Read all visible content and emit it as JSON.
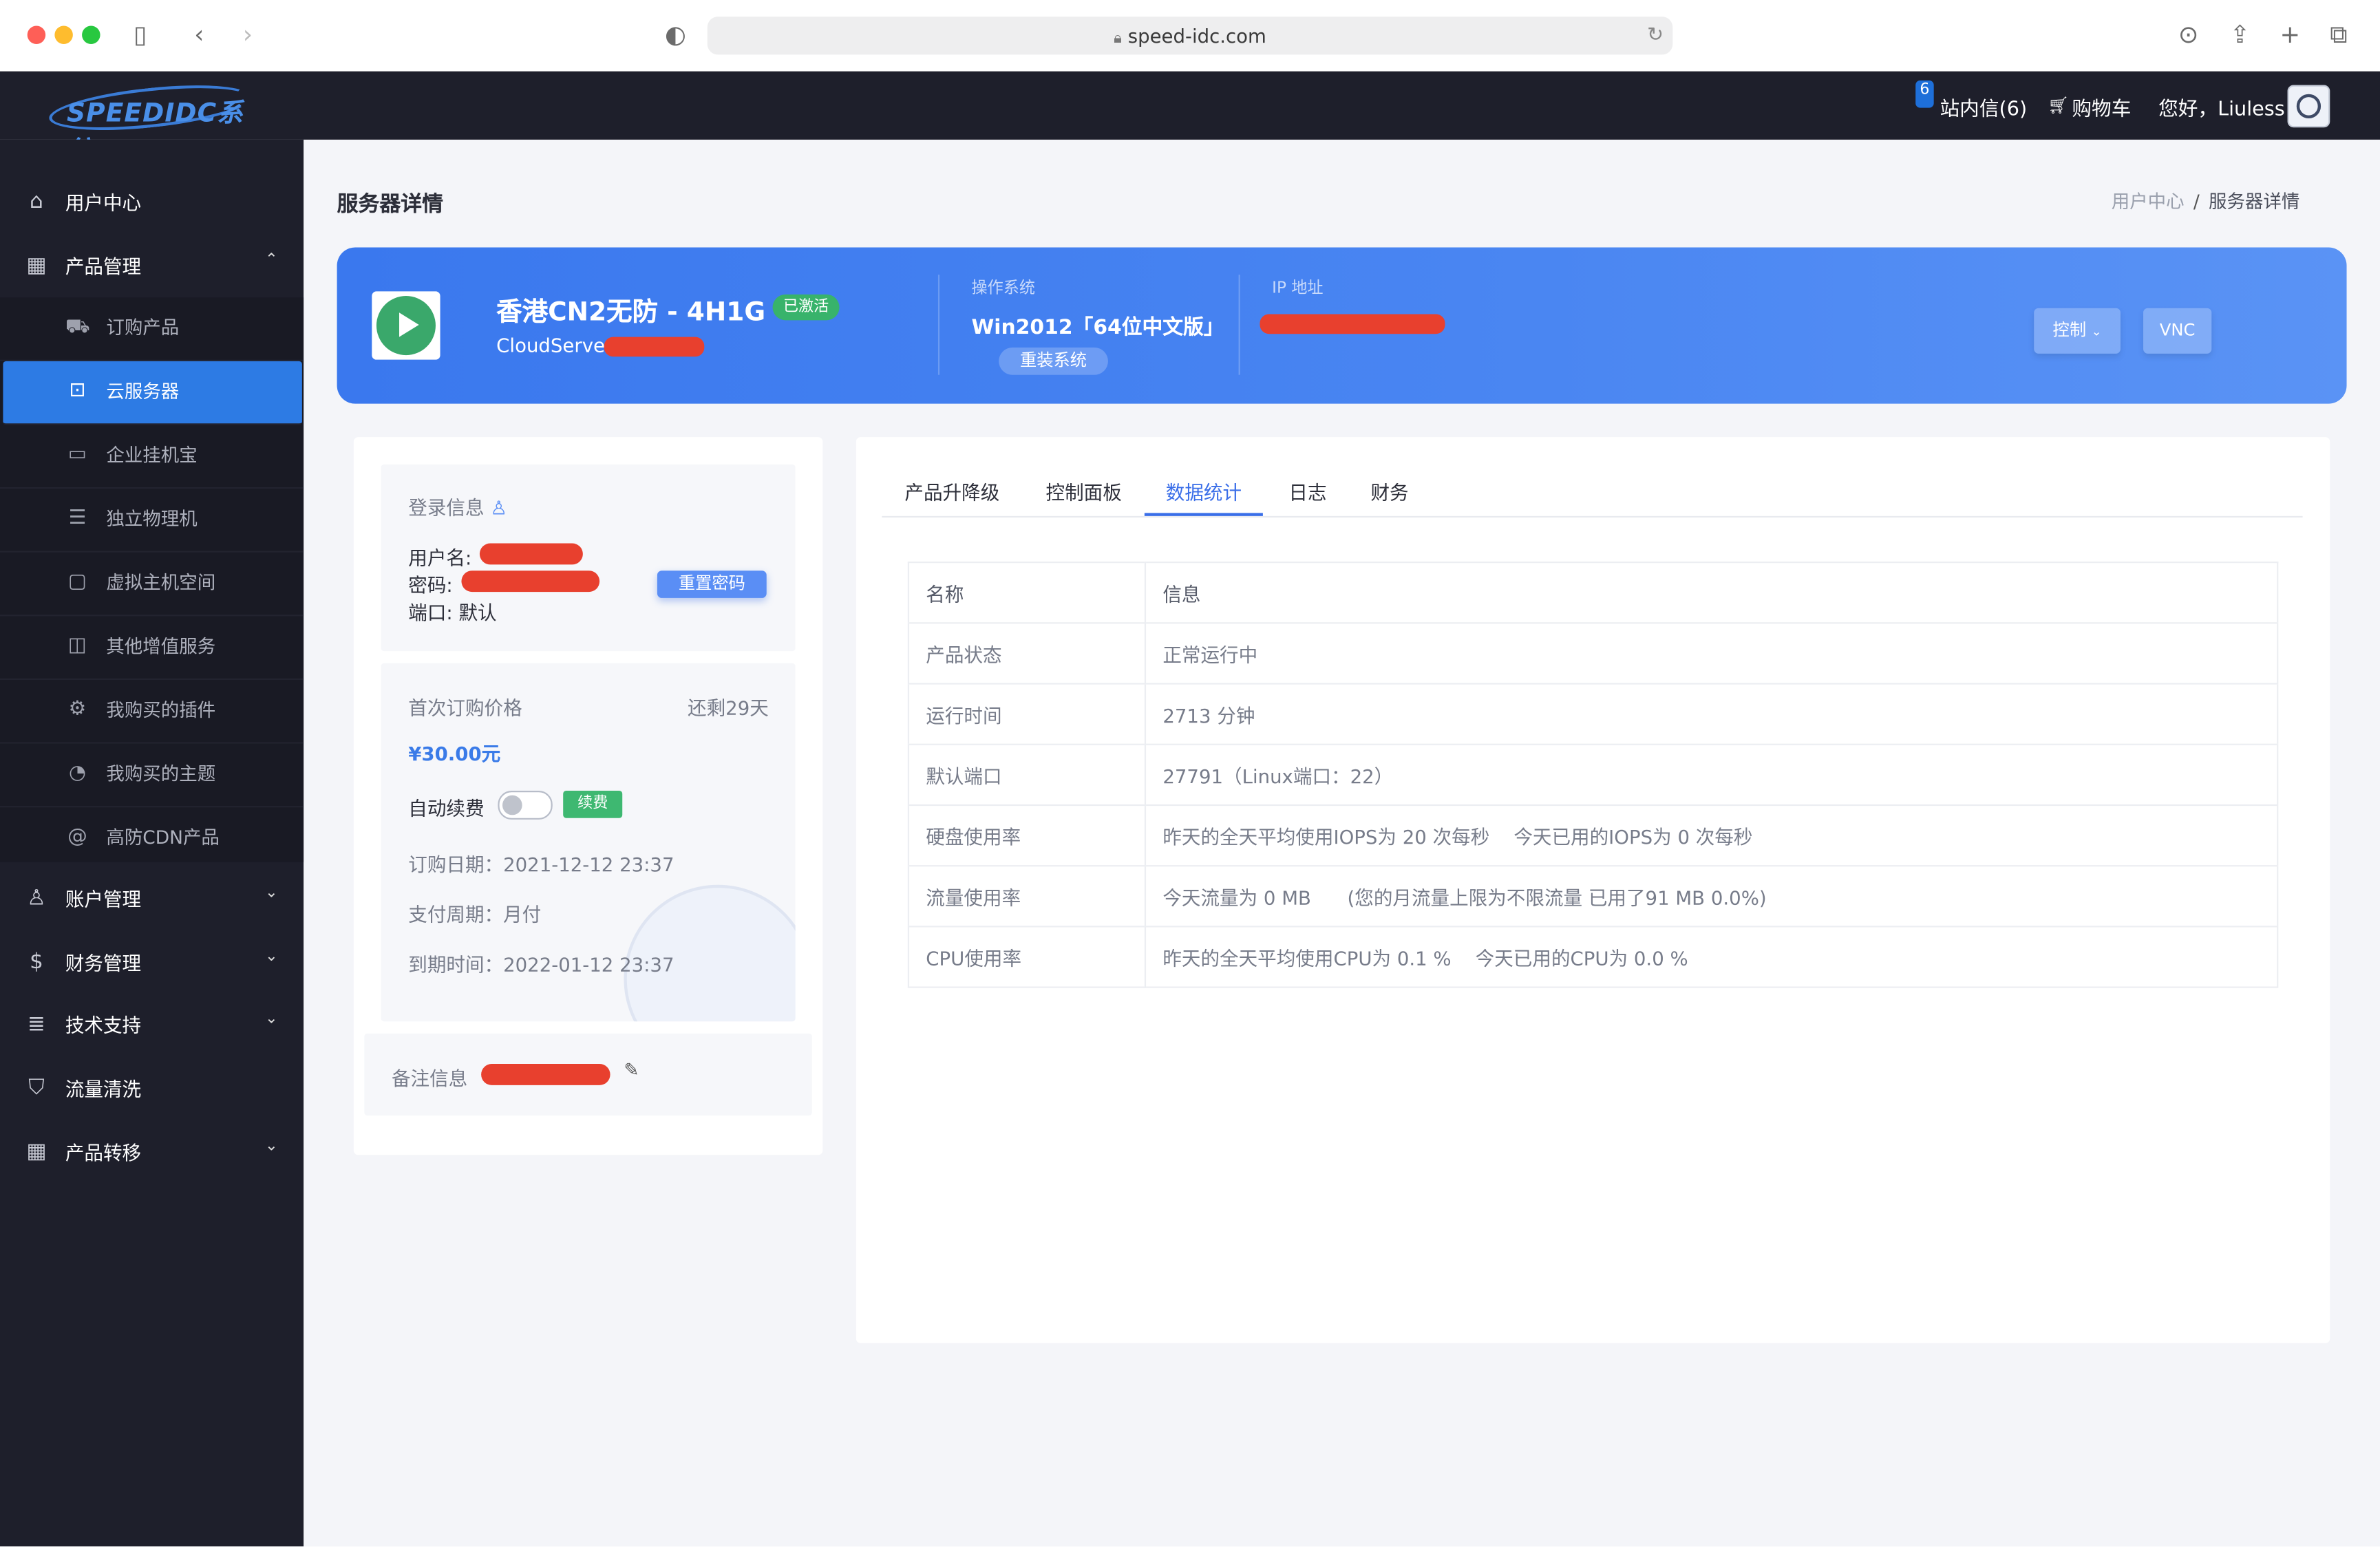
{
  "browser": {
    "url": "speed-idc.com"
  },
  "header": {
    "logo_text": "SPEEDIDC系统",
    "message_count": "6",
    "messages_label": "站内信(6)",
    "cart_label": "购物车",
    "greeting": "您好，Liuless"
  },
  "sidebar": {
    "items": [
      {
        "label": "用户中心",
        "icon": "home-icon"
      },
      {
        "label": "产品管理",
        "icon": "grid-icon",
        "expanded": true
      },
      {
        "label": "账户管理",
        "icon": "user-icon"
      },
      {
        "label": "财务管理",
        "icon": "dollar-icon"
      },
      {
        "label": "技术支持",
        "icon": "document-icon"
      },
      {
        "label": "流量清洗",
        "icon": "shield-icon"
      },
      {
        "label": "产品转移",
        "icon": "apps-icon"
      }
    ],
    "sub_items": [
      {
        "label": "订购产品",
        "icon": "cart-icon"
      },
      {
        "label": "云服务器",
        "icon": "cloud-server-icon",
        "active": true
      },
      {
        "label": "企业挂机宝",
        "icon": "monitor-icon"
      },
      {
        "label": "独立物理机",
        "icon": "server-icon"
      },
      {
        "label": "虚拟主机空间",
        "icon": "window-icon"
      },
      {
        "label": "其他增值服务",
        "icon": "briefcase-icon"
      },
      {
        "label": "我购买的插件",
        "icon": "chip-icon"
      },
      {
        "label": "我购买的主题",
        "icon": "pie-icon"
      },
      {
        "label": "高防CDN产品",
        "icon": "at-icon"
      }
    ]
  },
  "page": {
    "title": "服务器详情",
    "breadcrumb": [
      "用户中心",
      "服务器详情"
    ]
  },
  "server": {
    "name": "香港CN2无防 - 4H1G",
    "status_badge": "已激活",
    "hostname_prefix": "CloudServer",
    "os_label": "操作系统",
    "os_value": "Win2012「64位中文版」",
    "reinstall_label": "重装系统",
    "ip_label": "IP 地址",
    "control_label": "控制",
    "vnc_label": "VNC",
    "accent_color": "#3a78ee",
    "redacted_color": "#e8402e"
  },
  "login": {
    "title": "登录信息",
    "username_label": "用户名:",
    "password_label": "密码:",
    "port_label": "端口:",
    "port_value": "默认",
    "reset_label": "重置密码"
  },
  "billing": {
    "first_price_label": "首次订购价格",
    "remaining": "还剩29天",
    "price": "¥30.00元",
    "auto_renew_label": "自动续费",
    "auto_renew_on": false,
    "renew_label": "续费",
    "order_date": "订购日期：2021-12-12 23:37",
    "cycle": "支付周期：月付",
    "expire": "到期时间：2022-01-12 23:37"
  },
  "note": {
    "label": "备注信息"
  },
  "tabs": [
    {
      "label": "产品升降级"
    },
    {
      "label": "控制面板"
    },
    {
      "label": "数据统计",
      "active": true
    },
    {
      "label": "日志"
    },
    {
      "label": "财务"
    }
  ],
  "stats": {
    "headers": [
      "名称",
      "信息"
    ],
    "rows": [
      [
        "产品状态",
        "正常运行中"
      ],
      [
        "运行时间",
        "2713 分钟"
      ],
      [
        "默认端口",
        "27791（Linux端口：22）"
      ],
      [
        "硬盘使用率",
        "昨天的全天平均使用IOPS为 20 次每秒    今天已用的IOPS为 0 次每秒"
      ],
      [
        "流量使用率",
        "今天流量为 0 MB      (您的月流量上限为不限流量 已用了91 MB 0.0%)"
      ],
      [
        "CPU使用率",
        "昨天的全天平均使用CPU为 0.1 %    今天已用的CPU为 0.0 %"
      ]
    ]
  }
}
